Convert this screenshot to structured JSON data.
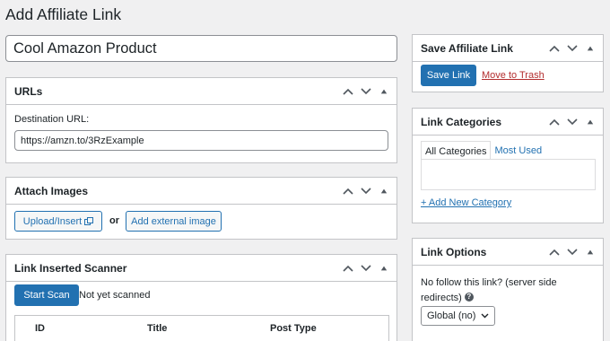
{
  "page": {
    "title": "Add Affiliate Link"
  },
  "title_field": {
    "value": "Cool Amazon Product"
  },
  "urls_box": {
    "title": "URLs",
    "destination_label": "Destination URL:",
    "destination_value": "https://amzn.to/3RzExample"
  },
  "images_box": {
    "title": "Attach Images",
    "upload_label": "Upload/Insert",
    "or_label": "or",
    "external_label": "Add external image"
  },
  "scanner_box": {
    "title": "Link Inserted Scanner",
    "scan_button": "Start Scan",
    "status": "Not yet scanned",
    "columns": [
      "ID",
      "Title",
      "Post Type"
    ]
  },
  "save_box": {
    "title": "Save Affiliate Link",
    "save_button": "Save Link",
    "trash_link": "Move to Trash"
  },
  "categories_box": {
    "title": "Link Categories",
    "tab_all": "All Categories",
    "tab_used": "Most Used",
    "add_new": "+ Add New Category"
  },
  "options_box": {
    "title": "Link Options",
    "nofollow_label": "No follow this link? (server side redirects)",
    "nofollow_value": "Global (no)"
  },
  "colors": {
    "primary": "#2271b1",
    "danger": "#b32d2e",
    "border": "#c3c4c7",
    "background": "#f0f0f1"
  }
}
